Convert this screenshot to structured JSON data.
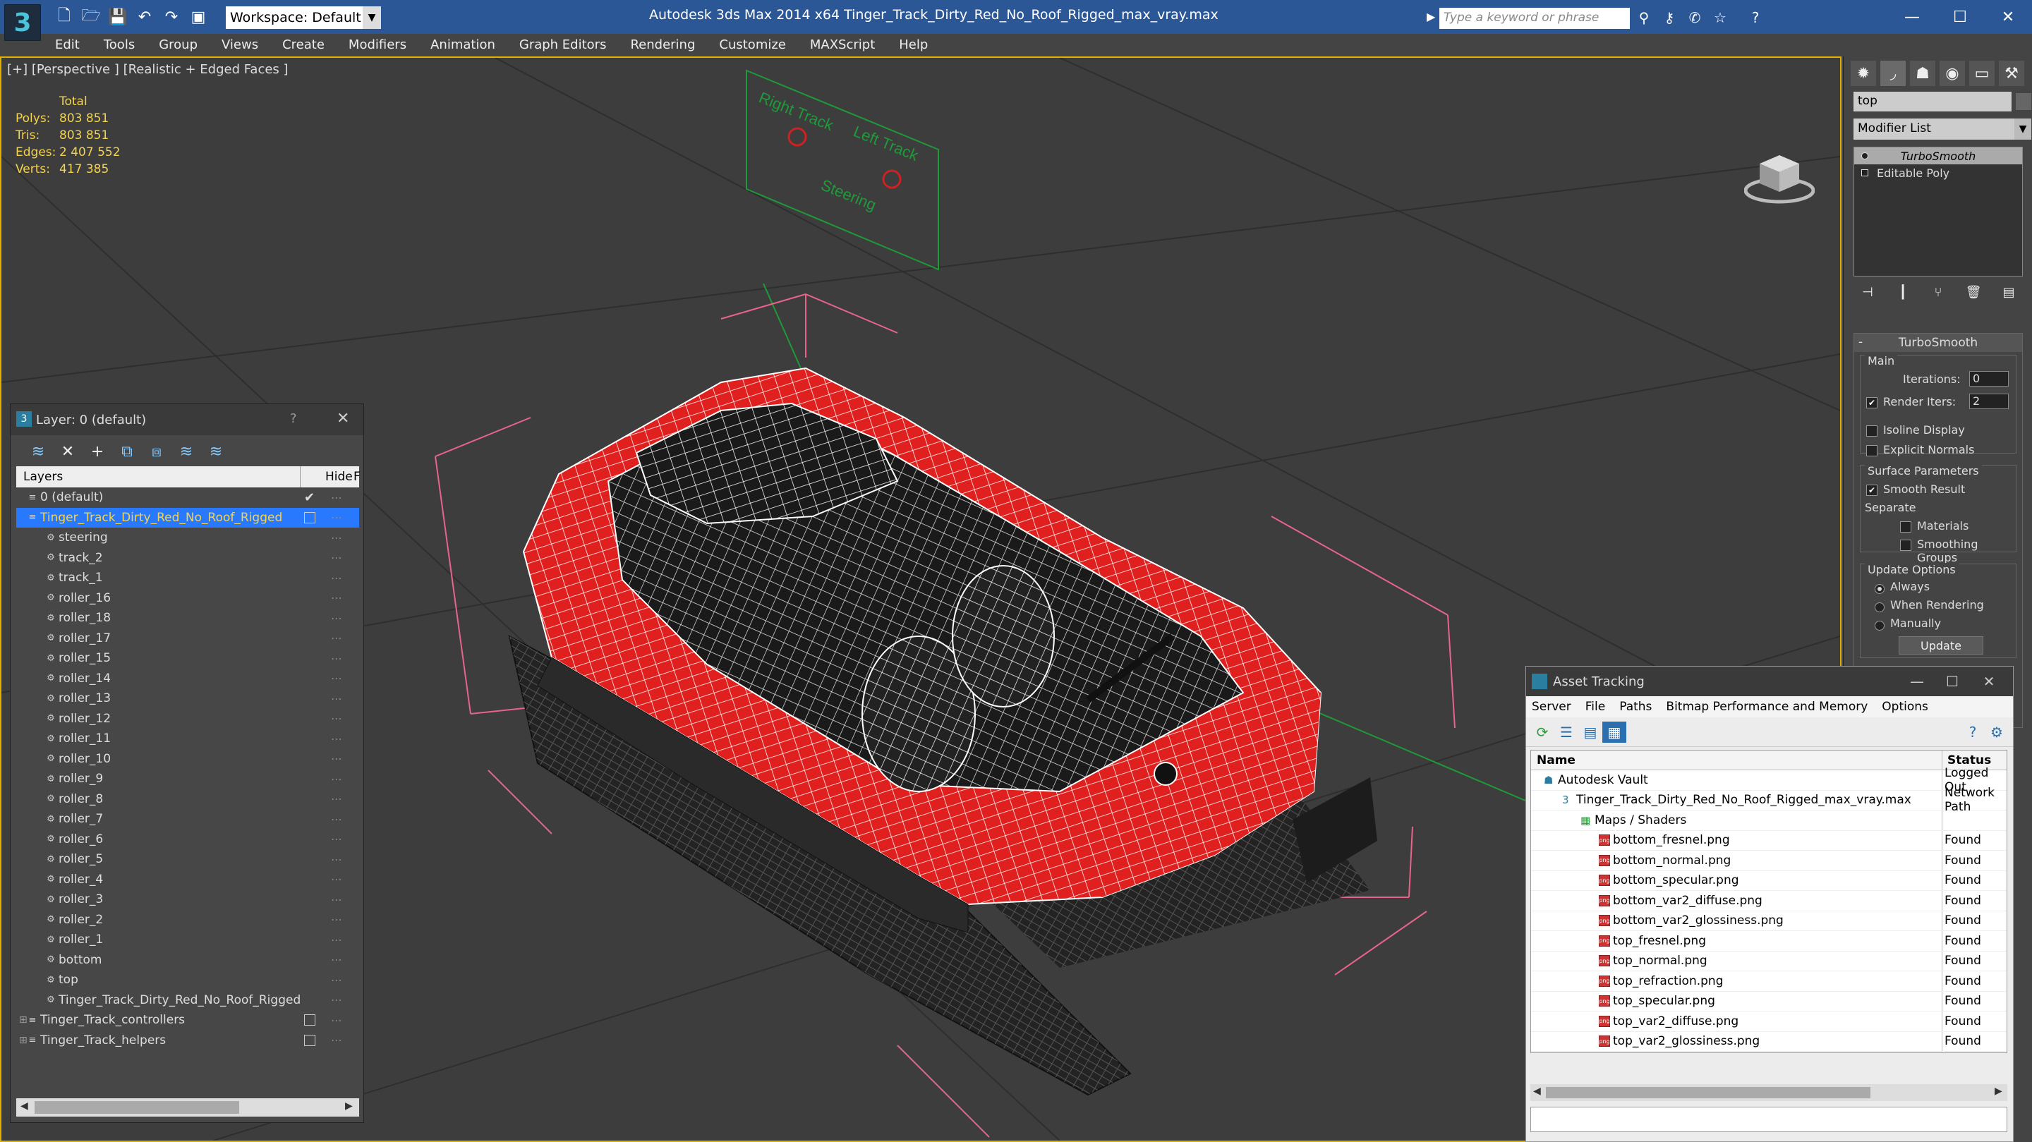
{
  "titlebar": {
    "app_title": "Autodesk 3ds Max  2014 x64     Tinger_Track_Dirty_Red_No_Roof_Rigged_max_vray.max",
    "workspace": "Workspace: Default",
    "search_placeholder": "Type a keyword or phrase"
  },
  "menu": [
    "Edit",
    "Tools",
    "Group",
    "Views",
    "Create",
    "Modifiers",
    "Animation",
    "Graph Editors",
    "Rendering",
    "Customize",
    "MAXScript",
    "Help"
  ],
  "viewport": {
    "label": "[+] [Perspective ] [Realistic + Edged Faces ]",
    "stats": {
      "header": "Total",
      "rows": [
        {
          "k": "Polys:",
          "v": "803 851"
        },
        {
          "k": "Tris:",
          "v": "803 851"
        },
        {
          "k": "Edges:",
          "v": "2 407 552"
        },
        {
          "k": "Verts:",
          "v": "417 385"
        }
      ]
    },
    "scene_labels": [
      "Right Track",
      "Left Track",
      "Steering"
    ]
  },
  "command_panel": {
    "object_name": "top",
    "modifier_list": "Modifier List",
    "stack": [
      "TurboSmooth",
      "Editable Poly"
    ],
    "turbosmooth": {
      "title": "TurboSmooth",
      "main": "Main",
      "iterations_label": "Iterations:",
      "iterations": "0",
      "render_iters_label": "Render Iters:",
      "render_iters": "2",
      "isoline": "Isoline Display",
      "explicit": "Explicit Normals",
      "surface": "Surface Parameters",
      "smooth_result": "Smooth Result",
      "separate": "Separate",
      "materials": "Materials",
      "smoothing_groups": "Smoothing Groups",
      "update_options": "Update Options",
      "always": "Always",
      "when_rendering": "When Rendering",
      "manually": "Manually",
      "update": "Update"
    }
  },
  "layer_panel": {
    "title": "Layer: 0 (default)",
    "help": "?",
    "col_layers": "Layers",
    "col_hide": "Hide",
    "col_f": "F",
    "rows": [
      {
        "label": "0 (default)",
        "indent": 0,
        "type": "layer",
        "check": true
      },
      {
        "label": "Tinger_Track_Dirty_Red_No_Roof_Rigged",
        "indent": 0,
        "type": "layer",
        "selected": true
      },
      {
        "label": "steering",
        "indent": 1,
        "type": "obj"
      },
      {
        "label": "track_2",
        "indent": 1,
        "type": "obj"
      },
      {
        "label": "track_1",
        "indent": 1,
        "type": "obj"
      },
      {
        "label": "roller_16",
        "indent": 1,
        "type": "obj"
      },
      {
        "label": "roller_18",
        "indent": 1,
        "type": "obj"
      },
      {
        "label": "roller_17",
        "indent": 1,
        "type": "obj"
      },
      {
        "label": "roller_15",
        "indent": 1,
        "type": "obj"
      },
      {
        "label": "roller_14",
        "indent": 1,
        "type": "obj"
      },
      {
        "label": "roller_13",
        "indent": 1,
        "type": "obj"
      },
      {
        "label": "roller_12",
        "indent": 1,
        "type": "obj"
      },
      {
        "label": "roller_11",
        "indent": 1,
        "type": "obj"
      },
      {
        "label": "roller_10",
        "indent": 1,
        "type": "obj"
      },
      {
        "label": "roller_9",
        "indent": 1,
        "type": "obj"
      },
      {
        "label": "roller_8",
        "indent": 1,
        "type": "obj"
      },
      {
        "label": "roller_7",
        "indent": 1,
        "type": "obj"
      },
      {
        "label": "roller_6",
        "indent": 1,
        "type": "obj"
      },
      {
        "label": "roller_5",
        "indent": 1,
        "type": "obj"
      },
      {
        "label": "roller_4",
        "indent": 1,
        "type": "obj"
      },
      {
        "label": "roller_3",
        "indent": 1,
        "type": "obj"
      },
      {
        "label": "roller_2",
        "indent": 1,
        "type": "obj"
      },
      {
        "label": "roller_1",
        "indent": 1,
        "type": "obj"
      },
      {
        "label": "bottom",
        "indent": 1,
        "type": "obj"
      },
      {
        "label": "top",
        "indent": 1,
        "type": "obj"
      },
      {
        "label": "Tinger_Track_Dirty_Red_No_Roof_Rigged",
        "indent": 1,
        "type": "obj"
      },
      {
        "label": "Tinger_Track_controllers",
        "indent": 0,
        "type": "layer",
        "expand": true
      },
      {
        "label": "Tinger_Track_helpers",
        "indent": 0,
        "type": "layer",
        "expand": true
      }
    ]
  },
  "asset_tracking": {
    "title": "Asset Tracking",
    "menu": [
      "Server",
      "File",
      "Paths",
      "Bitmap Performance and Memory",
      "Options"
    ],
    "col_name": "Name",
    "col_status": "Status",
    "rows": [
      {
        "name": "Autodesk Vault",
        "status": "Logged Out",
        "indent": 0,
        "type": "vault"
      },
      {
        "name": "Tinger_Track_Dirty_Red_No_Roof_Rigged_max_vray.max",
        "status": "Network Path",
        "indent": 1,
        "type": "max"
      },
      {
        "name": "Maps / Shaders",
        "status": "",
        "indent": 2,
        "type": "folder"
      },
      {
        "name": "bottom_fresnel.png",
        "status": "Found",
        "indent": 3,
        "type": "file"
      },
      {
        "name": "bottom_normal.png",
        "status": "Found",
        "indent": 3,
        "type": "file"
      },
      {
        "name": "bottom_specular.png",
        "status": "Found",
        "indent": 3,
        "type": "file"
      },
      {
        "name": "bottom_var2_diffuse.png",
        "status": "Found",
        "indent": 3,
        "type": "file"
      },
      {
        "name": "bottom_var2_glossiness.png",
        "status": "Found",
        "indent": 3,
        "type": "file"
      },
      {
        "name": "top_fresnel.png",
        "status": "Found",
        "indent": 3,
        "type": "file"
      },
      {
        "name": "top_normal.png",
        "status": "Found",
        "indent": 3,
        "type": "file"
      },
      {
        "name": "top_refraction.png",
        "status": "Found",
        "indent": 3,
        "type": "file"
      },
      {
        "name": "top_specular.png",
        "status": "Found",
        "indent": 3,
        "type": "file"
      },
      {
        "name": "top_var2_diffuse.png",
        "status": "Found",
        "indent": 3,
        "type": "file"
      },
      {
        "name": "top_var2_glossiness.png",
        "status": "Found",
        "indent": 3,
        "type": "file"
      }
    ]
  },
  "colors": {
    "titlebar": "#2b5797",
    "selection": "#2979ff",
    "stats": "#f5d34a",
    "model_red": "#e0201e"
  }
}
